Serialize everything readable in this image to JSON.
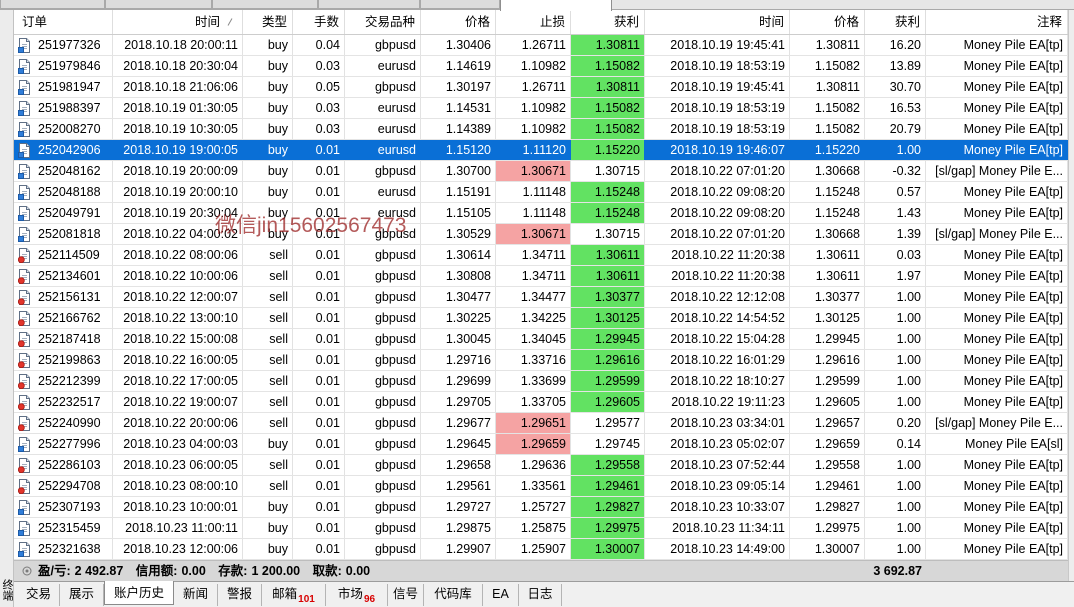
{
  "terminal": {
    "title": "终端"
  },
  "colors": {
    "tp_hit": "#62e262",
    "sl_hit": "#f5a3a3",
    "selected_row": "#0a6fd6",
    "badge": "#d80000",
    "watermark": "#9b2424"
  },
  "icons": {
    "buy": "buy-order-icon",
    "sell": "sell-order-icon",
    "summary": "summary-circle-icon",
    "sort": "sort-indicator-icon"
  },
  "history": {
    "columns": [
      "订单",
      "时间",
      "类型",
      "手数",
      "交易品种",
      "价格",
      "止损",
      "获利",
      "时间",
      "价格",
      "获利",
      "注释"
    ],
    "rows": [
      {
        "order": "251977326",
        "open_time": "2018.10.18 20:00:11",
        "type": "buy",
        "lots": "0.04",
        "symbol": "gbpusd",
        "open_price": "1.30406",
        "sl": "1.26711",
        "tp": "1.30811",
        "close_time": "2018.10.19 19:45:41",
        "close_price": "1.30811",
        "profit": "16.20",
        "comment": "Money Pile EA[tp]",
        "tp_hit": true
      },
      {
        "order": "251979846",
        "open_time": "2018.10.18 20:30:04",
        "type": "buy",
        "lots": "0.03",
        "symbol": "eurusd",
        "open_price": "1.14619",
        "sl": "1.10982",
        "tp": "1.15082",
        "close_time": "2018.10.19 18:53:19",
        "close_price": "1.15082",
        "profit": "13.89",
        "comment": "Money Pile EA[tp]",
        "tp_hit": true
      },
      {
        "order": "251981947",
        "open_time": "2018.10.18 21:06:06",
        "type": "buy",
        "lots": "0.05",
        "symbol": "gbpusd",
        "open_price": "1.30197",
        "sl": "1.26711",
        "tp": "1.30811",
        "close_time": "2018.10.19 19:45:41",
        "close_price": "1.30811",
        "profit": "30.70",
        "comment": "Money Pile EA[tp]",
        "tp_hit": true
      },
      {
        "order": "251988397",
        "open_time": "2018.10.19 01:30:05",
        "type": "buy",
        "lots": "0.03",
        "symbol": "eurusd",
        "open_price": "1.14531",
        "sl": "1.10982",
        "tp": "1.15082",
        "close_time": "2018.10.19 18:53:19",
        "close_price": "1.15082",
        "profit": "16.53",
        "comment": "Money Pile EA[tp]",
        "tp_hit": true
      },
      {
        "order": "252008270",
        "open_time": "2018.10.19 10:30:05",
        "type": "buy",
        "lots": "0.03",
        "symbol": "eurusd",
        "open_price": "1.14389",
        "sl": "1.10982",
        "tp": "1.15082",
        "close_time": "2018.10.19 18:53:19",
        "close_price": "1.15082",
        "profit": "20.79",
        "comment": "Money Pile EA[tp]",
        "tp_hit": true
      },
      {
        "order": "252042906",
        "open_time": "2018.10.19 19:00:05",
        "type": "buy",
        "lots": "0.01",
        "symbol": "eurusd",
        "open_price": "1.15120",
        "sl": "1.11120",
        "tp": "1.15220",
        "close_time": "2018.10.19 19:46:07",
        "close_price": "1.15220",
        "profit": "1.00",
        "comment": "Money Pile EA[tp]",
        "tp_hit": true,
        "selected": true
      },
      {
        "order": "252048162",
        "open_time": "2018.10.19 20:00:09",
        "type": "buy",
        "lots": "0.01",
        "symbol": "gbpusd",
        "open_price": "1.30700",
        "sl": "1.30671",
        "tp": "1.30715",
        "close_time": "2018.10.22 07:01:20",
        "close_price": "1.30668",
        "profit": "-0.32",
        "comment": "[sl/gap] Money Pile E...",
        "sl_hit": true
      },
      {
        "order": "252048188",
        "open_time": "2018.10.19 20:00:10",
        "type": "buy",
        "lots": "0.01",
        "symbol": "eurusd",
        "open_price": "1.15191",
        "sl": "1.11148",
        "tp": "1.15248",
        "close_time": "2018.10.22 09:08:20",
        "close_price": "1.15248",
        "profit": "0.57",
        "comment": "Money Pile EA[tp]",
        "tp_hit": true
      },
      {
        "order": "252049791",
        "open_time": "2018.10.19 20:30:04",
        "type": "buy",
        "lots": "0.01",
        "symbol": "eurusd",
        "open_price": "1.15105",
        "sl": "1.11148",
        "tp": "1.15248",
        "close_time": "2018.10.22 09:08:20",
        "close_price": "1.15248",
        "profit": "1.43",
        "comment": "Money Pile EA[tp]",
        "tp_hit": true
      },
      {
        "order": "252081818",
        "open_time": "2018.10.22 04:00:02",
        "type": "buy",
        "lots": "0.01",
        "symbol": "gbpusd",
        "open_price": "1.30529",
        "sl": "1.30671",
        "tp": "1.30715",
        "close_time": "2018.10.22 07:01:20",
        "close_price": "1.30668",
        "profit": "1.39",
        "comment": "[sl/gap] Money Pile E...",
        "sl_hit": true
      },
      {
        "order": "252114509",
        "open_time": "2018.10.22 08:00:06",
        "type": "sell",
        "lots": "0.01",
        "symbol": "gbpusd",
        "open_price": "1.30614",
        "sl": "1.34711",
        "tp": "1.30611",
        "close_time": "2018.10.22 11:20:38",
        "close_price": "1.30611",
        "profit": "0.03",
        "comment": "Money Pile EA[tp]",
        "tp_hit": true
      },
      {
        "order": "252134601",
        "open_time": "2018.10.22 10:00:06",
        "type": "sell",
        "lots": "0.01",
        "symbol": "gbpusd",
        "open_price": "1.30808",
        "sl": "1.34711",
        "tp": "1.30611",
        "close_time": "2018.10.22 11:20:38",
        "close_price": "1.30611",
        "profit": "1.97",
        "comment": "Money Pile EA[tp]",
        "tp_hit": true
      },
      {
        "order": "252156131",
        "open_time": "2018.10.22 12:00:07",
        "type": "sell",
        "lots": "0.01",
        "symbol": "gbpusd",
        "open_price": "1.30477",
        "sl": "1.34477",
        "tp": "1.30377",
        "close_time": "2018.10.22 12:12:08",
        "close_price": "1.30377",
        "profit": "1.00",
        "comment": "Money Pile EA[tp]",
        "tp_hit": true
      },
      {
        "order": "252166762",
        "open_time": "2018.10.22 13:00:10",
        "type": "sell",
        "lots": "0.01",
        "symbol": "gbpusd",
        "open_price": "1.30225",
        "sl": "1.34225",
        "tp": "1.30125",
        "close_time": "2018.10.22 14:54:52",
        "close_price": "1.30125",
        "profit": "1.00",
        "comment": "Money Pile EA[tp]",
        "tp_hit": true
      },
      {
        "order": "252187418",
        "open_time": "2018.10.22 15:00:08",
        "type": "sell",
        "lots": "0.01",
        "symbol": "gbpusd",
        "open_price": "1.30045",
        "sl": "1.34045",
        "tp": "1.29945",
        "close_time": "2018.10.22 15:04:28",
        "close_price": "1.29945",
        "profit": "1.00",
        "comment": "Money Pile EA[tp]",
        "tp_hit": true
      },
      {
        "order": "252199863",
        "open_time": "2018.10.22 16:00:05",
        "type": "sell",
        "lots": "0.01",
        "symbol": "gbpusd",
        "open_price": "1.29716",
        "sl": "1.33716",
        "tp": "1.29616",
        "close_time": "2018.10.22 16:01:29",
        "close_price": "1.29616",
        "profit": "1.00",
        "comment": "Money Pile EA[tp]",
        "tp_hit": true
      },
      {
        "order": "252212399",
        "open_time": "2018.10.22 17:00:05",
        "type": "sell",
        "lots": "0.01",
        "symbol": "gbpusd",
        "open_price": "1.29699",
        "sl": "1.33699",
        "tp": "1.29599",
        "close_time": "2018.10.22 18:10:27",
        "close_price": "1.29599",
        "profit": "1.00",
        "comment": "Money Pile EA[tp]",
        "tp_hit": true
      },
      {
        "order": "252232517",
        "open_time": "2018.10.22 19:00:07",
        "type": "sell",
        "lots": "0.01",
        "symbol": "gbpusd",
        "open_price": "1.29705",
        "sl": "1.33705",
        "tp": "1.29605",
        "close_time": "2018.10.22 19:11:23",
        "close_price": "1.29605",
        "profit": "1.00",
        "comment": "Money Pile EA[tp]",
        "tp_hit": true
      },
      {
        "order": "252240990",
        "open_time": "2018.10.22 20:00:06",
        "type": "sell",
        "lots": "0.01",
        "symbol": "gbpusd",
        "open_price": "1.29677",
        "sl": "1.29651",
        "tp": "1.29577",
        "close_time": "2018.10.23 03:34:01",
        "close_price": "1.29657",
        "profit": "0.20",
        "comment": "[sl/gap] Money Pile E...",
        "sl_hit": true
      },
      {
        "order": "252277996",
        "open_time": "2018.10.23 04:00:03",
        "type": "buy",
        "lots": "0.01",
        "symbol": "gbpusd",
        "open_price": "1.29645",
        "sl": "1.29659",
        "tp": "1.29745",
        "close_time": "2018.10.23 05:02:07",
        "close_price": "1.29659",
        "profit": "0.14",
        "comment": "Money Pile EA[sl]",
        "sl_hit": true
      },
      {
        "order": "252286103",
        "open_time": "2018.10.23 06:00:05",
        "type": "sell",
        "lots": "0.01",
        "symbol": "gbpusd",
        "open_price": "1.29658",
        "sl": "1.29636",
        "tp": "1.29558",
        "close_time": "2018.10.23 07:52:44",
        "close_price": "1.29558",
        "profit": "1.00",
        "comment": "Money Pile EA[tp]",
        "tp_hit": true
      },
      {
        "order": "252294708",
        "open_time": "2018.10.23 08:00:10",
        "type": "sell",
        "lots": "0.01",
        "symbol": "gbpusd",
        "open_price": "1.29561",
        "sl": "1.33561",
        "tp": "1.29461",
        "close_time": "2018.10.23 09:05:14",
        "close_price": "1.29461",
        "profit": "1.00",
        "comment": "Money Pile EA[tp]",
        "tp_hit": true
      },
      {
        "order": "252307193",
        "open_time": "2018.10.23 10:00:01",
        "type": "buy",
        "lots": "0.01",
        "symbol": "gbpusd",
        "open_price": "1.29727",
        "sl": "1.25727",
        "tp": "1.29827",
        "close_time": "2018.10.23 10:33:07",
        "close_price": "1.29827",
        "profit": "1.00",
        "comment": "Money Pile EA[tp]",
        "tp_hit": true
      },
      {
        "order": "252315459",
        "open_time": "2018.10.23 11:00:11",
        "type": "buy",
        "lots": "0.01",
        "symbol": "gbpusd",
        "open_price": "1.29875",
        "sl": "1.25875",
        "tp": "1.29975",
        "close_time": "2018.10.23 11:34:11",
        "close_price": "1.29975",
        "profit": "1.00",
        "comment": "Money Pile EA[tp]",
        "tp_hit": true
      },
      {
        "order": "252321638",
        "open_time": "2018.10.23 12:00:06",
        "type": "buy",
        "lots": "0.01",
        "symbol": "gbpusd",
        "open_price": "1.29907",
        "sl": "1.25907",
        "tp": "1.30007",
        "close_time": "2018.10.23 14:49:00",
        "close_price": "1.30007",
        "profit": "1.00",
        "comment": "Money Pile EA[tp]",
        "tp_hit": true
      }
    ]
  },
  "summary": {
    "pl_label": "盈/亏:",
    "pl": "2 492.87",
    "credit_label": "信用额:",
    "credit": "0.00",
    "deposit_label": "存款:",
    "deposit": "1 200.00",
    "withdrawal_label": "取款:",
    "withdrawal": "0.00",
    "total": "3 692.87"
  },
  "watermark": {
    "text": "微信jin15602567473"
  },
  "tabs": [
    {
      "label": "交易"
    },
    {
      "label": "展示"
    },
    {
      "label": "账户历史",
      "active": true
    },
    {
      "label": "新闻"
    },
    {
      "label": "警报"
    },
    {
      "label": "邮箱",
      "badge": "101"
    },
    {
      "label": "市场",
      "badge": "96"
    },
    {
      "label": "信号"
    },
    {
      "label": "代码库"
    },
    {
      "label": "EA"
    },
    {
      "label": "日志"
    }
  ]
}
